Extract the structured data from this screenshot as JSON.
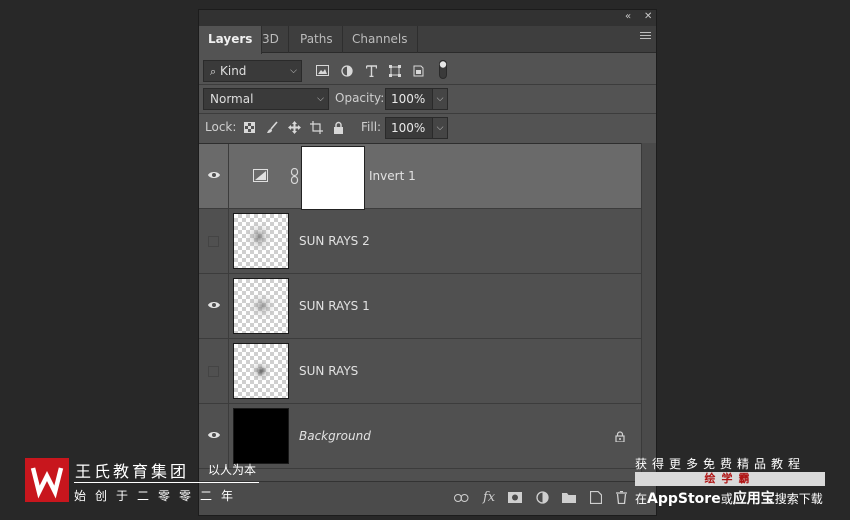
{
  "panel": {
    "tabs": [
      {
        "label": "Layers",
        "active": true
      },
      {
        "label": "3D",
        "active": false
      },
      {
        "label": "Paths",
        "active": false
      },
      {
        "label": "Channels",
        "active": false
      }
    ],
    "titlebar": {
      "collapse": "«",
      "close": "✕"
    }
  },
  "filter": {
    "kind_label": "Kind"
  },
  "blend": {
    "mode": "Normal",
    "opacity_label": "Opacity:",
    "opacity_value": "100%"
  },
  "lock": {
    "label": "Lock:",
    "fill_label": "Fill:",
    "fill_value": "100%"
  },
  "layers": [
    {
      "name": "Invert 1",
      "visible": true,
      "selected": true,
      "type": "adjustment"
    },
    {
      "name": "SUN RAYS 2",
      "visible": false,
      "selected": false,
      "type": "pixel"
    },
    {
      "name": "SUN RAYS 1",
      "visible": true,
      "selected": false,
      "type": "pixel"
    },
    {
      "name": "SUN RAYS",
      "visible": false,
      "selected": false,
      "type": "pixel"
    },
    {
      "name": "Background",
      "visible": true,
      "selected": false,
      "type": "background",
      "locked": true
    }
  ],
  "footer": {
    "icons": [
      "link-icon",
      "fx-icon",
      "mask-icon",
      "adjustment-icon",
      "group-folder-icon",
      "new-layer-icon",
      "trash-icon"
    ],
    "fx_label": "fx"
  },
  "watermark": {
    "brand": "王氏教育集团",
    "motto": "以人为本",
    "founded": "始创于二零零二年",
    "promo": "获得更多免费精品教程",
    "app_name": "绘学霸",
    "download_prefix": "在",
    "download_store1": "AppStore",
    "download_or": "或",
    "download_store2": "应用宝",
    "download_suffix": "搜索下载"
  },
  "colors": {
    "panel_bg": "#535353",
    "selected_row": "#6a6a6a",
    "logo_red": "#c8161d"
  }
}
